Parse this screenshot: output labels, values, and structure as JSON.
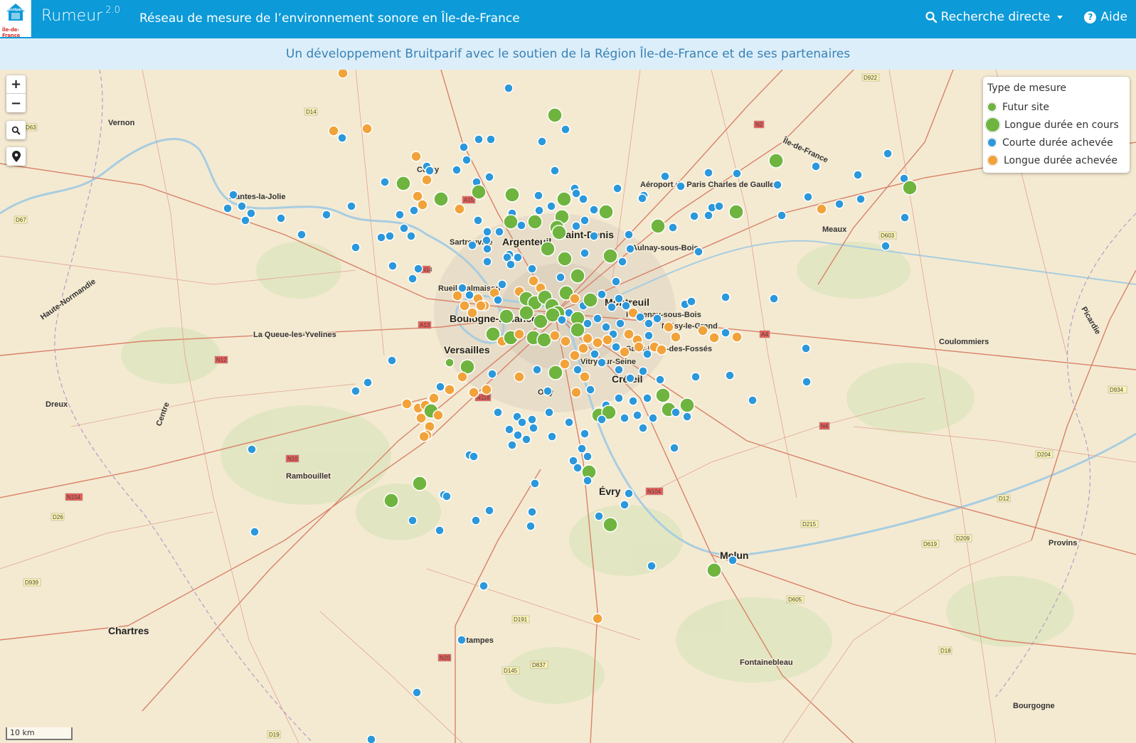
{
  "header": {
    "brand": "Rumeur",
    "version": "2.0",
    "subtitle": "Réseau de mesure de l’environnement sonore en Île-de-France",
    "search_label": "Recherche directe",
    "help_label": "Aide",
    "logo_text": "Île-de-France",
    "logo_brand": "Bruitparif"
  },
  "banner": {
    "text": "Un développement Bruitparif avec le soutien de la Région Île-de-France et de ses partenaires"
  },
  "map_controls": {
    "zoom_in": "+",
    "zoom_out": "−",
    "scale_label": "10 km"
  },
  "legend": {
    "title": "Type de mesure",
    "items": [
      {
        "label": "Futur site",
        "color": "#6fb43f",
        "type": "future"
      },
      {
        "label": "Longue durée en cours",
        "color": "#6fb43f",
        "type": "long-current"
      },
      {
        "label": "Courte durée achevée",
        "color": "#2b98db",
        "type": "short-done"
      },
      {
        "label": "Longue durée achevée",
        "color": "#f1a33a",
        "type": "long-done"
      }
    ]
  },
  "places": [
    {
      "name": "Vernon"
    },
    {
      "name": "Mantes-la-Jolie"
    },
    {
      "name": "Cergy"
    },
    {
      "name": "Sartrouville"
    },
    {
      "name": "Argenteuil"
    },
    {
      "name": "Saint-Denis"
    },
    {
      "name": "Aéroport de Paris Charles de Gaulle"
    },
    {
      "name": "Aulnay-sous-Bois"
    },
    {
      "name": "Meaux"
    },
    {
      "name": "Rueil-Malmaison"
    },
    {
      "name": "Montreuil"
    },
    {
      "name": "Fontenay-sous-Bois"
    },
    {
      "name": "Boulogne-Billancourt"
    },
    {
      "name": "Noisy-le-Grand"
    },
    {
      "name": "Coulommiers"
    },
    {
      "name": "La Queue-les-Yvelines"
    },
    {
      "name": "Versailles"
    },
    {
      "name": "Saint-Maur-des-Fossés"
    },
    {
      "name": "Vitry-sur-Seine"
    },
    {
      "name": "Créteil"
    },
    {
      "name": "Dreux"
    },
    {
      "name": "Orly"
    },
    {
      "name": "Rambouillet"
    },
    {
      "name": "Évry"
    },
    {
      "name": "Provins"
    },
    {
      "name": "Melun"
    },
    {
      "name": "Chartres"
    },
    {
      "name": "Étampes"
    },
    {
      "name": "Fontainebleau"
    },
    {
      "name": "Bourgogne"
    },
    {
      "name": "Picardie"
    },
    {
      "name": "Haute-Normandie"
    },
    {
      "name": "Centre"
    },
    {
      "name": "Île-de-France"
    }
  ],
  "roads": [
    "D14",
    "D922",
    "D63",
    "D67",
    "A15",
    "N2",
    "N14",
    "D603",
    "A13",
    "N12",
    "A4",
    "N118",
    "D934",
    "N4",
    "N10",
    "D204",
    "N104",
    "N154",
    "D26",
    "D12",
    "D215",
    "D619",
    "D209",
    "D939",
    "D605",
    "D191",
    "N20",
    "D837",
    "D145",
    "D18",
    "D19"
  ],
  "markers": {
    "note": "measurement sites rendered on map",
    "colors": {
      "future": "#6fb43f",
      "short": "#2b98db",
      "long": "#f1a33a"
    }
  }
}
